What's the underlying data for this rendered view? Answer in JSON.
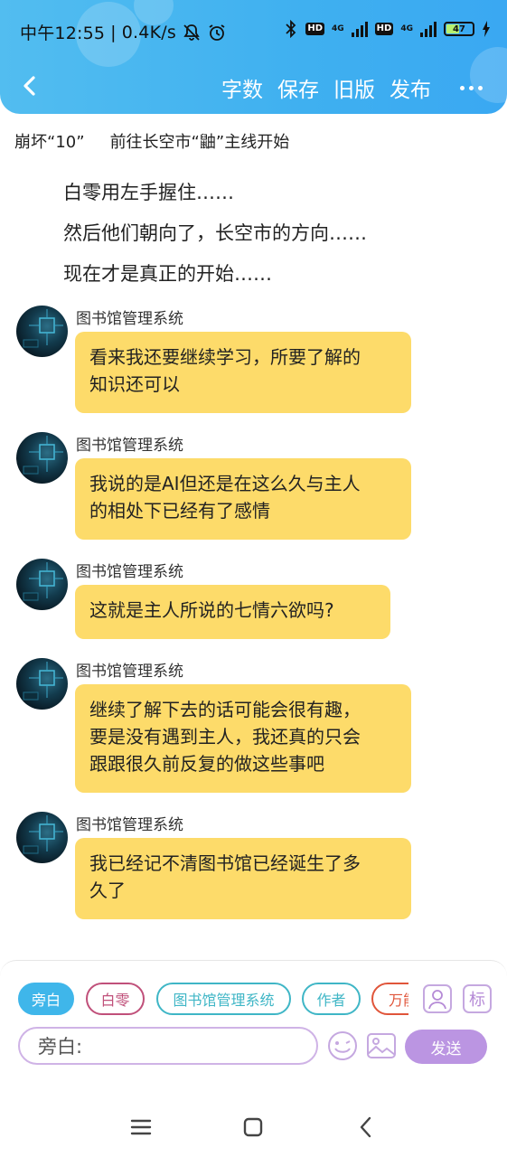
{
  "status_bar": {
    "time": "中午12:55",
    "net_speed": "0.4K/s",
    "separator": "|",
    "network1": "4G",
    "network2": "4G",
    "hd1": "HD",
    "hd2": "HD",
    "battery": "47",
    "icons": [
      "mute-icon",
      "alarm-icon",
      "bluetooth-icon",
      "charging-icon"
    ]
  },
  "toolbar": {
    "back": "back-icon",
    "actions": [
      "字数",
      "保存",
      "旧版",
      "发布"
    ],
    "more": "more-icon"
  },
  "breadcrumb": {
    "book": "崩坏“10”",
    "chapter": "前往长空市“鼬”主线开始"
  },
  "narration": [
    "白零用左手握住……",
    "然后他们朝向了，长空市的方向……",
    "现在才是真正的开始……"
  ],
  "messages": [
    {
      "sender": "图书馆管理系统",
      "lines": [
        "看来我还要继续学习，所要了解的",
        "知识还可以"
      ]
    },
    {
      "sender": "图书馆管理系统",
      "lines": [
        "我说的是AI但还是在这么久与主人",
        "的相处下已经有了感情"
      ]
    },
    {
      "sender": "图书馆管理系统",
      "lines": [
        "这就是主人所说的七情六欲吗?"
      ]
    },
    {
      "sender": "图书馆管理系统",
      "lines": [
        "继续了解下去的话可能会很有趣，",
        "要是没有遇到主人，我还真的只会",
        "跟跟很久前反复的做这些事吧"
      ]
    },
    {
      "sender": "图书馆管理系统",
      "lines": [
        "我已经记不清图书馆已经诞生了多",
        "久了"
      ]
    }
  ],
  "composer": {
    "roles": [
      {
        "label": "旁白",
        "color": "#3fb6ea",
        "selected": true
      },
      {
        "label": "白零",
        "color": "#c0507a",
        "selected": false
      },
      {
        "label": "图书馆管理系统",
        "color": "#3fb6c6",
        "selected": false
      },
      {
        "label": "作者",
        "color": "#3fb6c6",
        "selected": false
      },
      {
        "label": "万能",
        "color": "#e0553a",
        "selected": false
      }
    ],
    "role_icon": "person-icon",
    "tag_label": "标",
    "input_placeholder": "旁白:",
    "emoji_icon": "emoji-icon",
    "image_icon": "image-icon",
    "send_label": "发送"
  },
  "system_nav": [
    "menu-icon",
    "home-icon",
    "back-icon"
  ],
  "colors": {
    "header": "#3fb0f0",
    "bubble": "#fddb6a",
    "accent_purple": "#bb95e2"
  }
}
